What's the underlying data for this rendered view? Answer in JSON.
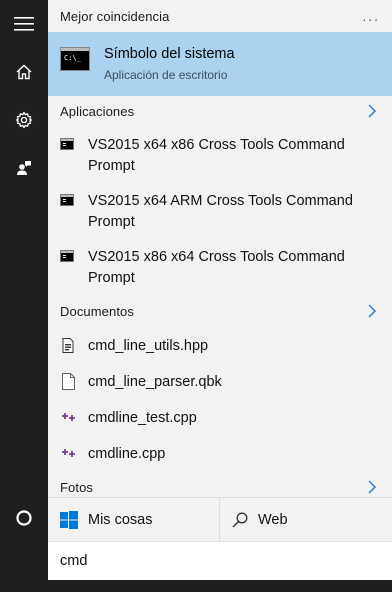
{
  "rail": {
    "items": [
      {
        "icon": "hamburger-menu-icon"
      },
      {
        "icon": "home-icon"
      },
      {
        "icon": "gear-icon"
      },
      {
        "icon": "user-feedback-icon"
      },
      {
        "icon": "cortana-circle-icon"
      }
    ]
  },
  "best_match": {
    "header": "Mejor coincidencia",
    "more_label": "...",
    "title": "Símbolo del sistema",
    "subtitle": "Aplicación de escritorio",
    "icon_glyph": "C:\\_"
  },
  "apps": {
    "header": "Aplicaciones",
    "items": [
      {
        "line1": "VS2015 x64 x86 Cross Tools Command",
        "line2": "Prompt"
      },
      {
        "line1": "VS2015 x64 ARM Cross Tools Command",
        "line2": "Prompt"
      },
      {
        "line1": "VS2015 x86 x64 Cross Tools Command",
        "line2": "Prompt"
      }
    ]
  },
  "documents": {
    "header": "Documentos",
    "items": [
      {
        "name": "cmd_line_utils.hpp",
        "icon": "header-file-icon"
      },
      {
        "name": "cmd_line_parser.qbk",
        "icon": "blank-file-icon"
      },
      {
        "name": "cmdline_test.cpp",
        "icon": "cpp-file-icon"
      },
      {
        "name": "cmdline.cpp",
        "icon": "cpp-file-icon"
      }
    ]
  },
  "photos": {
    "header": "Fotos"
  },
  "bottom": {
    "my_stuff": "Mis cosas",
    "web": "Web"
  },
  "search": {
    "value": "cmd"
  },
  "colors": {
    "rail_bg": "#1f1f1f",
    "panel_bg": "#f2f2f2",
    "best_match_bg": "#a9d3f0",
    "accent": "#0078d7",
    "cpp_icon": "#7a3b99"
  }
}
